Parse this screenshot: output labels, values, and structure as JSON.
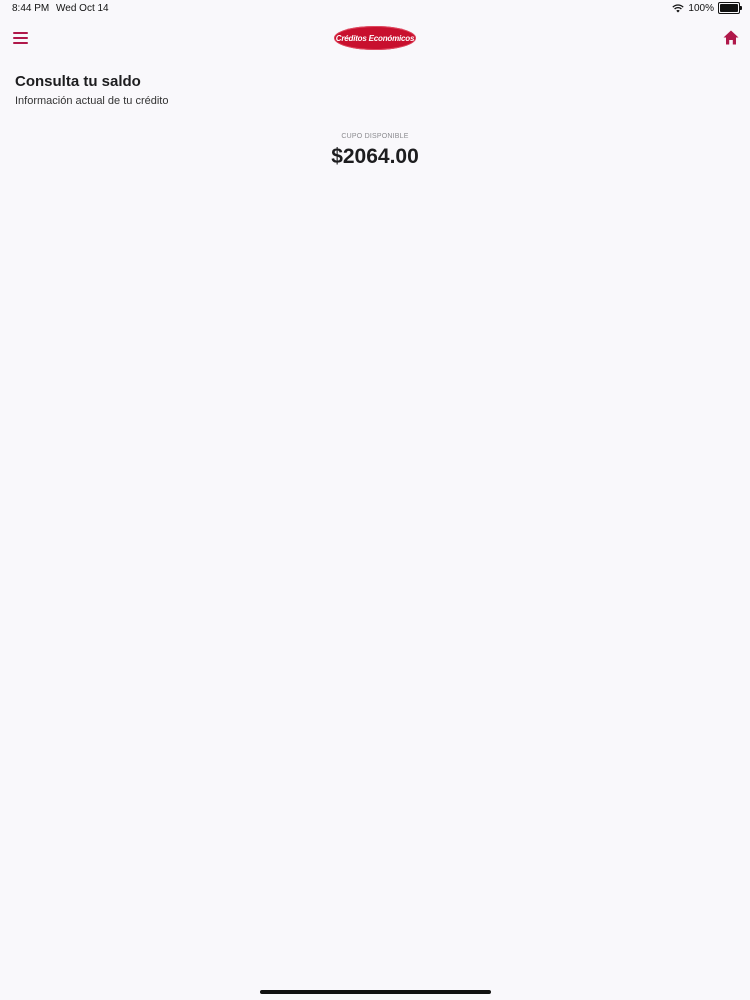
{
  "status_bar": {
    "time": "8:44 PM",
    "date": "Wed Oct 14",
    "battery": "100%",
    "icons": [
      "wifi-icon",
      "battery-icon"
    ]
  },
  "nav": {
    "logo_text": "Créditos Económicos",
    "menu_icon": "hamburger-menu-icon",
    "home_icon": "home-icon"
  },
  "page": {
    "title": "Consulta tu saldo",
    "subtitle": "Información actual de tu crédito"
  },
  "balance": {
    "label": "CUPO DISPONIBLE",
    "amount": "$2064.00"
  },
  "colors": {
    "accent": "#b0184a",
    "brand_red": "#c8102e",
    "background": "#f9f8fb"
  }
}
